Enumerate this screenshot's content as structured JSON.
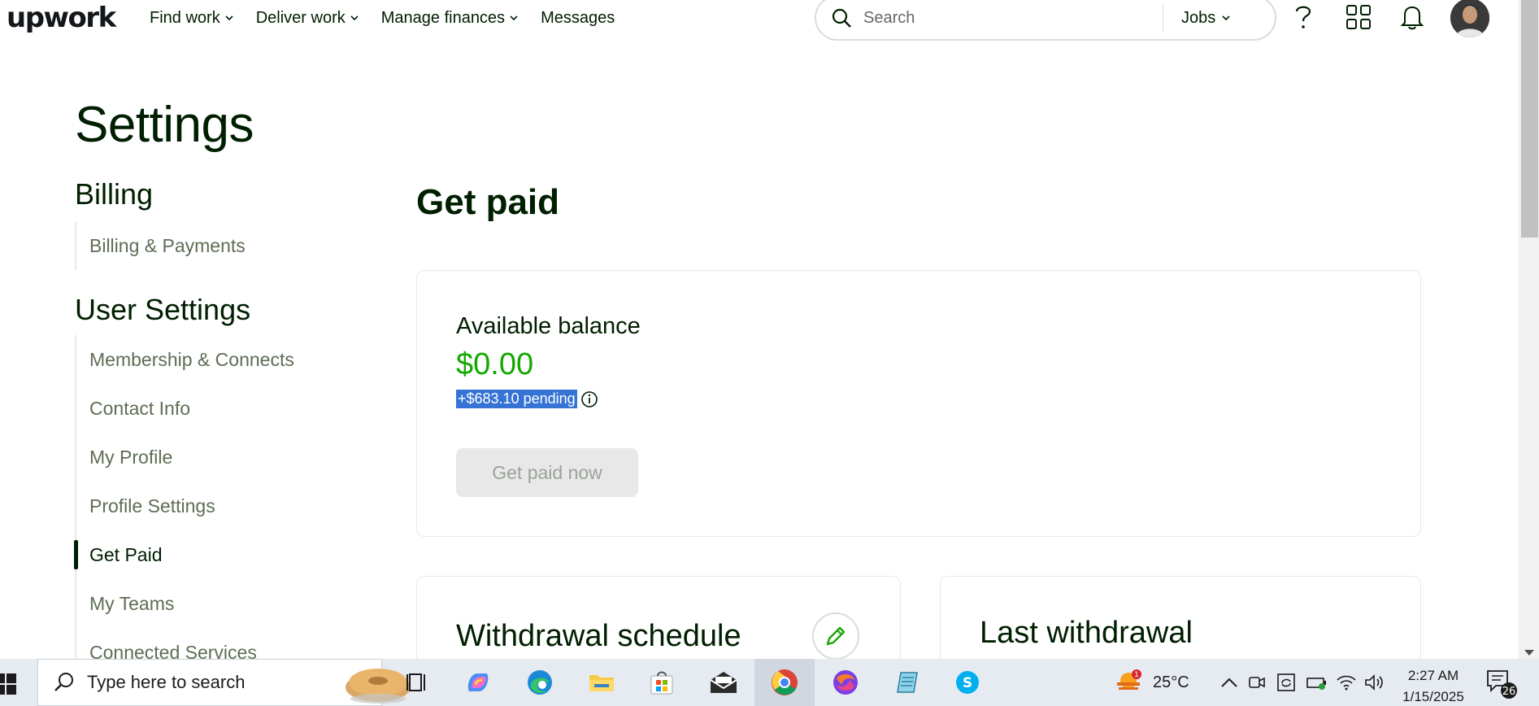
{
  "nav": {
    "logo": "upwork",
    "links": [
      "Find work",
      "Deliver work",
      "Manage finances",
      "Messages"
    ],
    "search_placeholder": "Search",
    "search_scope": "Jobs"
  },
  "page": {
    "title": "Settings",
    "billing_heading": "Billing",
    "billing_items": [
      "Billing & Payments"
    ],
    "user_heading": "User Settings",
    "user_items": [
      "Membership & Connects",
      "Contact Info",
      "My Profile",
      "Profile Settings",
      "Get Paid",
      "My Teams",
      "Connected Services"
    ],
    "active_item": "Get Paid"
  },
  "content": {
    "title": "Get paid",
    "balance_label": "Available balance",
    "balance_value": "$0.00",
    "pending_text": "+$683.10 pending",
    "get_paid_now": "Get paid now",
    "withdrawal_schedule": "Withdrawal schedule",
    "last_withdrawal": "Last withdrawal"
  },
  "taskbar": {
    "search_placeholder": "Type here to search",
    "weather_temp": "25°C",
    "weather_badge": "1",
    "time": "2:27 AM",
    "date": "1/15/2025",
    "notif_count": "26"
  },
  "colors": {
    "accent_green": "#14a800",
    "selection_blue": "#3574d4",
    "text": "#001e00"
  }
}
